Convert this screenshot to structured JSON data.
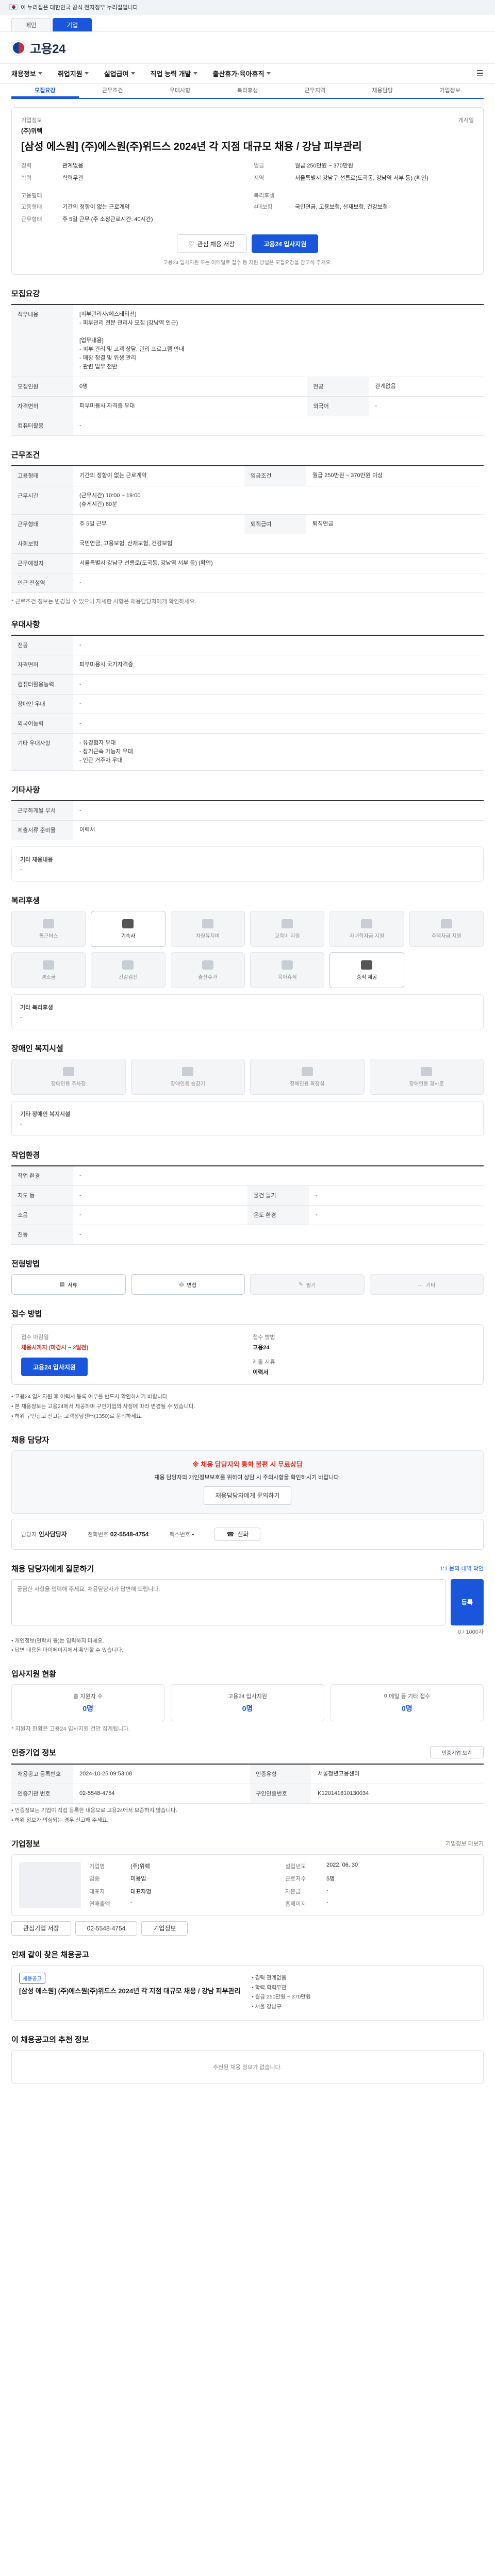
{
  "gov_bar": {
    "text": "이 누리집은 대한민국 공식 전자정부 누리집입니다."
  },
  "top_tabs": [
    "메인",
    "기업"
  ],
  "logo": {
    "text": "고용24"
  },
  "gnb": [
    "채용정보",
    "취업지원",
    "실업급여",
    "직업 능력 개발",
    "출산휴가·육아휴직"
  ],
  "subtabs": [
    "모집요강",
    "근무조건",
    "우대사항",
    "복리후생",
    "근무지역",
    "채용담당",
    "기업정보"
  ],
  "summary": {
    "company_label": "기업정보",
    "company": "(주)위렉",
    "posted_label": "게시일",
    "title": "[삼성 에스원] (주)에스원(주)위드스 2024년 각 지점 대규모 채용 / 강남 피부관리",
    "left": [
      {
        "k": "경력",
        "v": "관계없음"
      },
      {
        "k": "학력",
        "v": "학력무관"
      }
    ],
    "right": [
      {
        "k": "임금",
        "v": "월급 250만원 ~ 370만원"
      },
      {
        "k": "지역",
        "v": "서울특별시 강남구 선릉로(도곡동, 강남역 서부 등) (확인)"
      }
    ],
    "employ_label": "고용형태",
    "employ": [
      {
        "k": "고용형태",
        "v": "기간의 정함이 없는 근로계약"
      },
      {
        "k": "근무형태",
        "v": "주 5일 근무 (주 소정근로시간: 40시간)"
      }
    ],
    "work_label": "복리후생",
    "work": [
      {
        "k": "",
        "v": ""
      },
      {
        "k": "4대보험",
        "v": "국민연금, 고용보험, 산재보험, 건강보험"
      }
    ],
    "btn_save": "관심 채용 저장",
    "btn_apply": "고용24 입사지원",
    "notice": "고용24 입사지원 또는 이메일로 접수 등 지원 방법은 모집요강을 참고해 주세요."
  },
  "recruit": {
    "title": "모집요강",
    "rows": [
      {
        "k": "직무내용",
        "v": "[피부관리사/에스테티션]\n- 피부관리 전문 관리사 모집 (강남역 인근)\n\n[업무내용]\n- 피부 관리 및 고객 상담, 관리 프로그램 안내\n- 매장 청결 및 위생 관리\n- 관련 업무 전반"
      },
      {
        "k": "모집인원",
        "v": "0명"
      },
      {
        "k": "전공",
        "v": "관계없음"
      },
      {
        "k": "자격면허",
        "v": "피부미용사 자격증 우대"
      },
      {
        "k": "외국어",
        "v": "-"
      },
      {
        "k": "컴퓨터활용",
        "v": "-"
      }
    ]
  },
  "conditions": {
    "title": "근무조건",
    "rows": [
      {
        "k": "고용형태",
        "v": "기간의 정함이 없는 근로계약"
      },
      {
        "k": "임금조건",
        "v": "월급 250만원 ~ 370만원 이상"
      },
      {
        "k": "근무시간",
        "v": "(근무시간) 10:00 ~ 19:00\n(휴게시간) 60분"
      },
      {
        "k": "근무형태",
        "v": "주 5일 근무"
      },
      {
        "k": "퇴직급여",
        "v": "퇴직연금"
      },
      {
        "k": "사회보험",
        "v": "국민연금, 고용보험, 산재보험, 건강보험"
      },
      {
        "k": "근무예정지",
        "v": "서울특별시 강남구 선릉로(도곡동, 강남역 서부 등) (확인)"
      },
      {
        "k": "인근 전철역",
        "v": "-"
      }
    ],
    "footnote": "* 근로조건 정보는 변경될 수 있으니 자세한 사항은 채용담당자에게 확인하세요."
  },
  "preference": {
    "title": "우대사항",
    "rows": [
      {
        "k": "전공",
        "v": "-"
      },
      {
        "k": "자격면허",
        "v": "피부미용사 국가자격증"
      },
      {
        "k": "컴퓨터활용능력",
        "v": "-"
      },
      {
        "k": "장애인 우대",
        "v": "-"
      },
      {
        "k": "외국어능력",
        "v": "-"
      },
      {
        "k": "기타 우대사항",
        "v": "- 유경험자 우대\n- 장기근속 가능자 우대\n- 인근 거주자 우대"
      }
    ]
  },
  "documents": {
    "title": "기타사항",
    "rows": [
      {
        "k": "근무하게될 부서",
        "v": "-"
      },
      {
        "k": "제출서류 준비물",
        "v": "이력서"
      }
    ],
    "extra_label": "기타 채용내용",
    "extra_value": "-"
  },
  "welfare": {
    "title": "복리후생",
    "tiles": [
      {
        "label": "통근버스",
        "on": false
      },
      {
        "label": "기숙사",
        "on": true
      },
      {
        "label": "차량유지비",
        "on": false
      },
      {
        "label": "교육비 지원",
        "on": false
      },
      {
        "label": "자녀학자금 지원",
        "on": false
      },
      {
        "label": "주택자금 지원",
        "on": false
      },
      {
        "label": "경조금",
        "on": false
      },
      {
        "label": "건강검진",
        "on": false
      },
      {
        "label": "출산휴가",
        "on": false
      },
      {
        "label": "육아휴직",
        "on": false
      },
      {
        "label": "중식 제공",
        "on": true
      }
    ],
    "extra_label": "기타 복리후생",
    "extra_value": "-"
  },
  "disability": {
    "title": "장애인 복지시설",
    "tiles": [
      {
        "label": "장애인용 주차장",
        "on": false
      },
      {
        "label": "장애인용 승강기",
        "on": false
      },
      {
        "label": "장애인용 화장실",
        "on": false
      },
      {
        "label": "장애인용 경사로",
        "on": false
      }
    ],
    "extra_label": "기타 장애인 복지시설",
    "extra_value": "-"
  },
  "env": {
    "title": "작업환경",
    "rows": [
      {
        "k": "작업 환경",
        "v": "-"
      },
      {
        "k": "지도 등",
        "v": "-"
      },
      {
        "k": "물건 들기",
        "v": "-"
      },
      {
        "k": "소음",
        "v": "-"
      },
      {
        "k": "온도 환경",
        "v": "-"
      },
      {
        "k": "진동",
        "v": "-"
      }
    ]
  },
  "methods": {
    "title": "전형방법",
    "items": [
      "서류",
      "면접",
      "필기",
      "기타"
    ]
  },
  "apply": {
    "title": "접수 방법",
    "deadline_label": "접수 마감일",
    "deadline": "채용시까지 (마감시 ~ 2일전)",
    "method_label": "접수 방법",
    "method": "고용24",
    "btn_apply": "고용24 입사지원",
    "form_label": "제출 서류",
    "form": "이력서",
    "bullets": [
      "고용24 입사지원 후 이력서 등록 여부를 반드시 확인하시기 바랍니다.",
      "본 채용정보는 고용24에서 제공하며 구인기업의 사정에 따라 변경될 수 있습니다.",
      "허위 구인광고 신고는 고객상담센터(1350)로 문의하세요."
    ]
  },
  "contact": {
    "title": "채용 담당자",
    "alert_head": "※ 채용 담당자와 통화 불편 시 무료상담",
    "alert_body": "채용 담당자의 개인정보보호를 위하여 상담 시 주의사항을 확인하시기 바랍니다.",
    "alert_btn": "채용담당자에게 문의하기",
    "name_label": "담당자",
    "name": "인사담당자",
    "tel_label": "전화번호",
    "tel": "02-5548-4754",
    "fax_label": "팩스번호",
    "fax": "-",
    "call_btn": "전화"
  },
  "qna": {
    "title": "채용 담당자에게 질문하기",
    "link": "1:1 문의 내역 확인",
    "placeholder": "궁금한 사항을 입력해 주세요. 채용담당자가 답변해 드립니다.",
    "counter": "0 / 1000자",
    "btn": "등록",
    "notes": [
      "개인정보(연락처 등)는 입력하지 마세요.",
      "답변 내용은 마이페이지에서 확인할 수 있습니다."
    ]
  },
  "stats": {
    "title": "입사지원 현황",
    "items": [
      {
        "label": "총 지원자 수",
        "value": "0명"
      },
      {
        "label": "고용24 입사지원",
        "value": "0명"
      },
      {
        "label": "이메일 등 기타 접수",
        "value": "0명"
      }
    ],
    "note": "* 지원자 현황은 고용24 입사지원 건만 집계됩니다."
  },
  "posting": {
    "title": "인증기업 정보",
    "link": "인증기업 보기",
    "rows": [
      {
        "k": "채용공고 등록번호",
        "v": "2024-10-25 09:53:08",
        "k2": "인증유형",
        "v2": "서울청년고용센터"
      },
      {
        "k": "인증기관 번호",
        "v": "02-5548-4754",
        "k2": "구인인증번호",
        "v2": "K120141610130034"
      }
    ],
    "bullets": [
      "인증정보는 기업이 직접 등록한 내용으로 고용24에서 보증하지 않습니다.",
      "허위 정보가 의심되는 경우 신고해 주세요."
    ]
  },
  "company": {
    "title": "기업정보",
    "link": "기업정보 더보기",
    "info": [
      {
        "k": "기업명",
        "v": "(주)위렉"
      },
      {
        "k": "업종",
        "v": "미용업"
      },
      {
        "k": "대표자",
        "v": "대표자명"
      },
      {
        "k": "설립년도",
        "v": "2022. 06. 30"
      },
      {
        "k": "근로자수",
        "v": "5명"
      },
      {
        "k": "자본금",
        "v": "-"
      },
      {
        "k": "연매출액",
        "v": "-"
      },
      {
        "k": "홈페이지",
        "v": "-"
      }
    ],
    "btn_save": "관심기업 저장",
    "btn_tel": "02-5548-4754",
    "btn_more": "기업정보"
  },
  "similar": {
    "title": "인재 같이 찾은 채용공고",
    "chip": "채용공고",
    "item_title": "[삼성 에스원] (주)에스원(주)위드스 2024년 각 지점 대규모 채용 / 강남 피부관리",
    "meta": [
      "경력 관계없음",
      "학력 학력무관",
      "월급 250만원 ~ 370만원",
      "서울 강남구"
    ]
  },
  "recommend": {
    "title": "이 채용공고의 추천 정보",
    "empty": "추천된 채용 정보가 없습니다."
  }
}
